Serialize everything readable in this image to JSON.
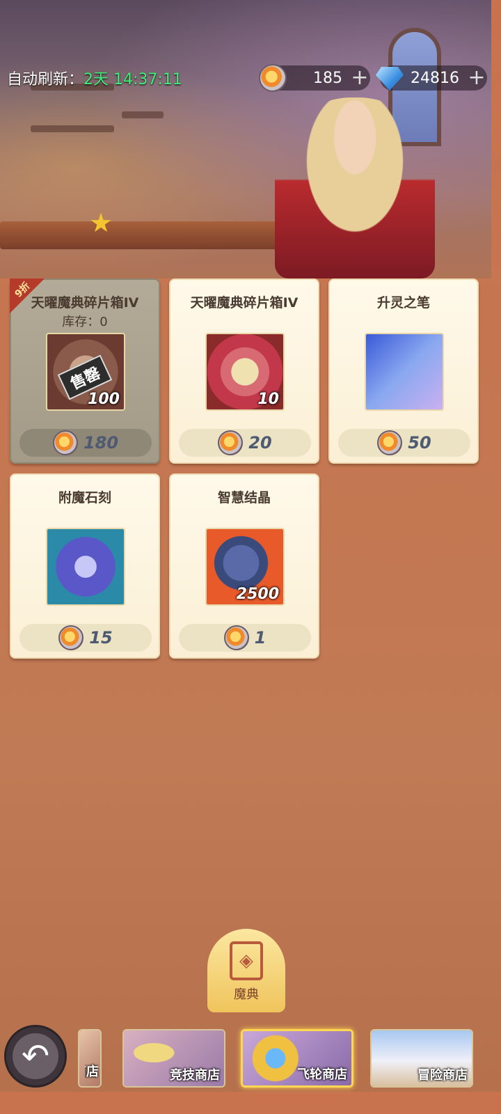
{
  "header": {
    "refresh_label": "自动刷新：",
    "refresh_timer": "2天 14:37:11"
  },
  "currencies": {
    "coin": {
      "icon": "wheel-coin-icon",
      "value": "185"
    },
    "diamond": {
      "icon": "diamond-icon",
      "value": "24816"
    },
    "plus_symbol": "+"
  },
  "items": [
    {
      "name": "天曜魔典碎片箱IV",
      "stock": "库存：0",
      "qty": "100",
      "price": "180",
      "discount": "9折",
      "sold_out": "售罄"
    },
    {
      "name": "天曜魔典碎片箱IV",
      "qty": "10",
      "price": "20"
    },
    {
      "name": "升灵之笔",
      "qty": "",
      "price": "50"
    },
    {
      "name": "附魔石刻",
      "qty": "",
      "price": "15"
    },
    {
      "name": "智慧结晶",
      "qty": "2500",
      "price": "1"
    }
  ],
  "nav": {
    "center_tab": "魔典",
    "back_symbol": "↶",
    "tabs": [
      {
        "label": "商店"
      },
      {
        "label": "竞技商店"
      },
      {
        "label": "飞轮商店"
      },
      {
        "label": "冒险商店"
      }
    ]
  }
}
